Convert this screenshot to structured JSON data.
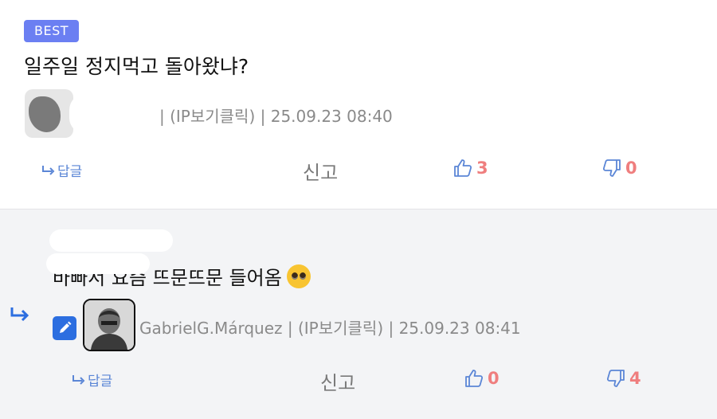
{
  "best_comment": {
    "badge": "BEST",
    "text": "일주일 정지먹고 돌아왔냐?",
    "meta": "| (IP보기클릭) | 25.09.23 08:40",
    "reply_label": "답글",
    "report_label": "신고",
    "likes": "3",
    "dislikes": "0"
  },
  "reply_comment": {
    "text": "바빠서 요즘 뜨문뜨문 들어옴",
    "author_meta": "GabrielG.Márquez | (IP보기클릭) | 25.09.23 08:41",
    "reply_label": "답글",
    "report_label": "신고",
    "likes": "0",
    "dislikes": "4"
  },
  "colors": {
    "badge": "#6b7ff2",
    "vote_count": "#ef7e7e",
    "vote_icon": "#5b86d6",
    "pen_button": "#2c6ee0"
  }
}
